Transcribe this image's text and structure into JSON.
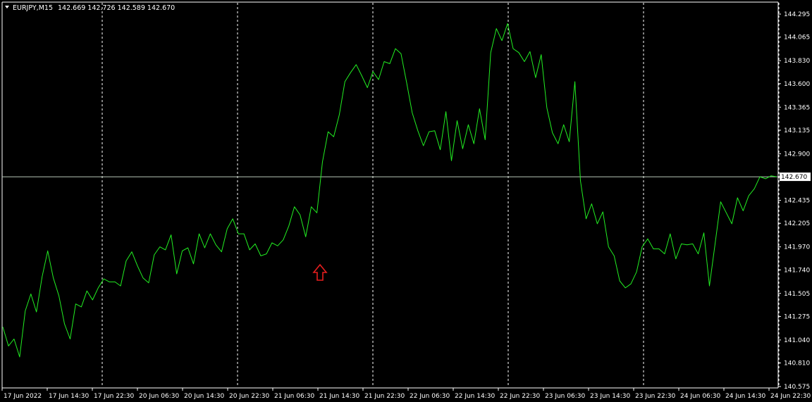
{
  "header": {
    "symbol": "EURJPY,M15",
    "ohlc": "142.669 142.726 142.589 142.670"
  },
  "colors": {
    "background": "#000000",
    "price_line": "#22ee22",
    "grid": "#ffffff",
    "bid_line": "#b8c8b8",
    "arrow": "#e61e1e"
  },
  "chart_data": {
    "type": "line",
    "title": "EURJPY,M15",
    "ylim": [
      140.575,
      144.295
    ],
    "y_ticks": [
      "144.295",
      "144.065",
      "143.830",
      "143.600",
      "143.365",
      "143.135",
      "142.900",
      "142.670",
      "142.435",
      "142.205",
      "141.970",
      "141.740",
      "141.505",
      "141.275",
      "141.040",
      "140.810",
      "140.575"
    ],
    "x_ticks": [
      "17 Jun 2022",
      "17 Jun 14:30",
      "17 Jun 22:30",
      "20 Jun 06:30",
      "20 Jun 14:30",
      "20 Jun 22:30",
      "21 Jun 06:30",
      "21 Jun 14:30",
      "21 Jun 22:30",
      "22 Jun 06:30",
      "22 Jun 14:30",
      "22 Jun 22:30",
      "23 Jun 06:30",
      "23 Jun 14:30",
      "23 Jun 22:30",
      "24 Jun 06:30",
      "24 Jun 14:30",
      "24 Jun 22:30"
    ],
    "current_price": "142.670",
    "grid": "vertical-dashed",
    "series": [
      {
        "values": [
          141.17,
          140.98,
          141.05,
          140.87,
          141.33,
          141.5,
          141.32,
          141.67,
          141.93,
          141.66,
          141.48,
          141.2,
          141.05,
          141.4,
          141.37,
          141.53,
          141.44,
          141.56,
          141.65,
          141.62,
          141.62,
          141.58,
          141.83,
          141.92,
          141.78,
          141.66,
          141.61,
          141.89,
          141.97,
          141.94,
          142.09,
          141.7,
          141.93,
          141.96,
          141.8,
          142.1,
          141.96,
          142.1,
          141.99,
          141.92,
          142.15,
          142.25,
          142.1,
          142.1,
          141.94,
          142.0,
          141.88,
          141.9,
          142.01,
          141.98,
          142.04,
          142.18,
          142.37,
          142.29,
          142.07,
          142.37,
          142.31,
          142.82,
          143.12,
          143.07,
          143.29,
          143.62,
          143.71,
          143.79,
          143.68,
          143.56,
          143.72,
          143.64,
          143.82,
          143.8,
          143.95,
          143.9,
          143.61,
          143.31,
          143.13,
          142.98,
          143.12,
          143.13,
          142.94,
          143.32,
          142.83,
          143.23,
          142.95,
          143.19,
          143.0,
          143.35,
          143.04,
          143.91,
          144.15,
          144.03,
          144.2,
          143.95,
          143.91,
          143.82,
          143.92,
          143.66,
          143.89,
          143.36,
          143.11,
          143.0,
          143.19,
          143.02,
          143.62,
          142.63,
          142.25,
          142.4,
          142.2,
          142.32,
          141.97,
          141.88,
          141.63,
          141.56,
          141.6,
          141.72,
          141.97,
          142.05,
          141.95,
          141.95,
          141.9,
          142.1,
          141.85,
          142.0,
          141.99,
          142.0,
          141.9,
          142.11,
          141.58,
          142.0,
          142.42,
          142.31,
          142.2,
          142.46,
          142.33,
          142.48,
          142.55,
          142.67,
          142.65,
          142.68,
          142.67
        ]
      }
    ]
  }
}
